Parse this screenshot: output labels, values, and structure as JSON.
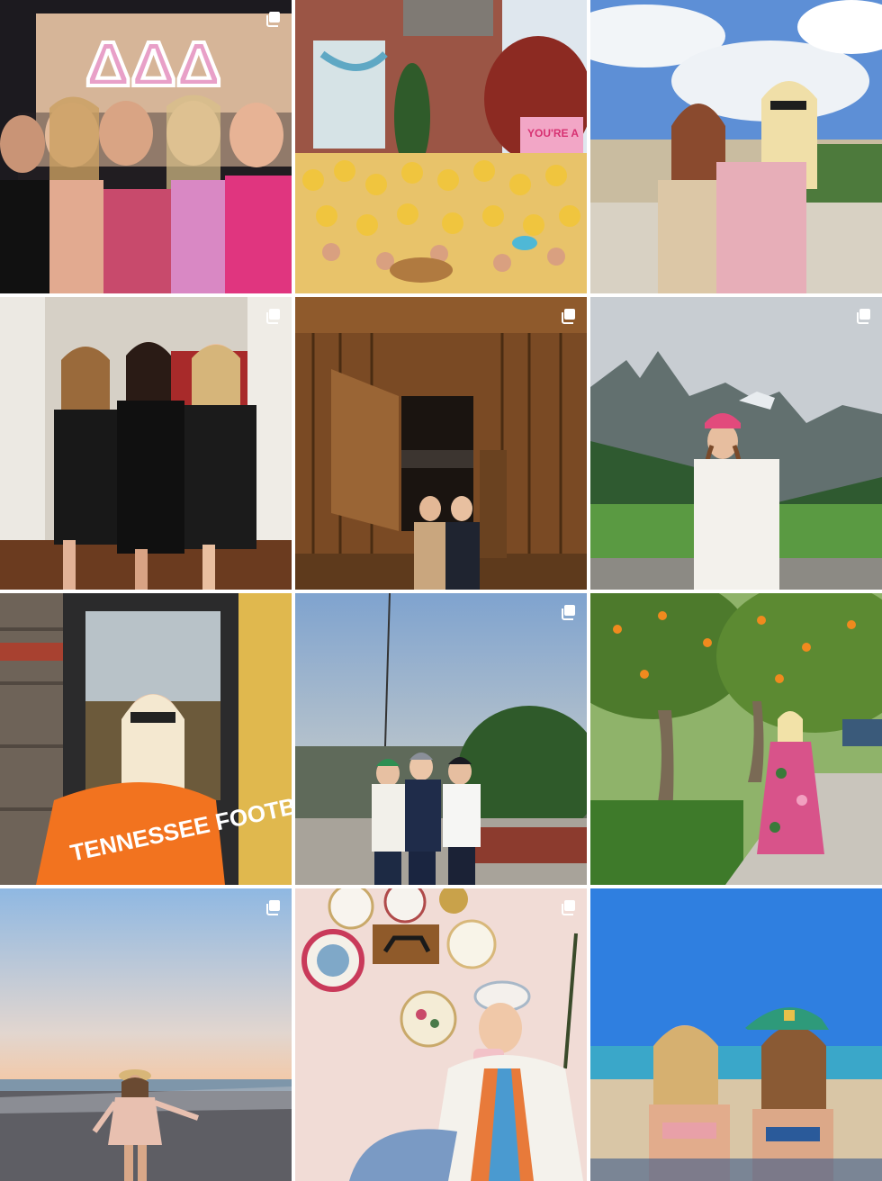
{
  "grid": {
    "columns": 3,
    "rows": 4,
    "gap_color": "#ffffff",
    "posts": [
      {
        "id": "post-1",
        "subject": "group photo in front of sorority banner",
        "multi": true,
        "banner_letters": "ΔΔΔ"
      },
      {
        "id": "post-2",
        "subject": "crowd in yellow hats outside brick house",
        "multi": false,
        "sign_text": "YOU'RE A"
      },
      {
        "id": "post-3",
        "subject": "two friends on terrace under blue sky",
        "multi": false
      },
      {
        "id": "post-4",
        "subject": "three women in black dresses",
        "multi": true
      },
      {
        "id": "post-5",
        "subject": "two friends in front of wooden barn",
        "multi": true
      },
      {
        "id": "post-6",
        "subject": "hiker in pink cap with mountains",
        "multi": true
      },
      {
        "id": "post-7",
        "subject": "woman in orange sweatshirt and sunglasses",
        "multi": false,
        "shirt_text": "TENNESSEE FOOTBALL"
      },
      {
        "id": "post-8",
        "subject": "three friends in winter hats at dusk",
        "multi": true
      },
      {
        "id": "post-9",
        "subject": "woman in floral dress under orange trees",
        "multi": false
      },
      {
        "id": "post-10",
        "subject": "woman walking on beach at sunset",
        "multi": true
      },
      {
        "id": "post-11",
        "subject": "woman sipping tea under wall of plates",
        "multi": true
      },
      {
        "id": "post-12",
        "subject": "two friends on beach in bikinis and cap",
        "multi": false
      }
    ]
  },
  "icons": {
    "multi": "carousel-icon"
  },
  "colors": {
    "icon": "#ffffff"
  }
}
